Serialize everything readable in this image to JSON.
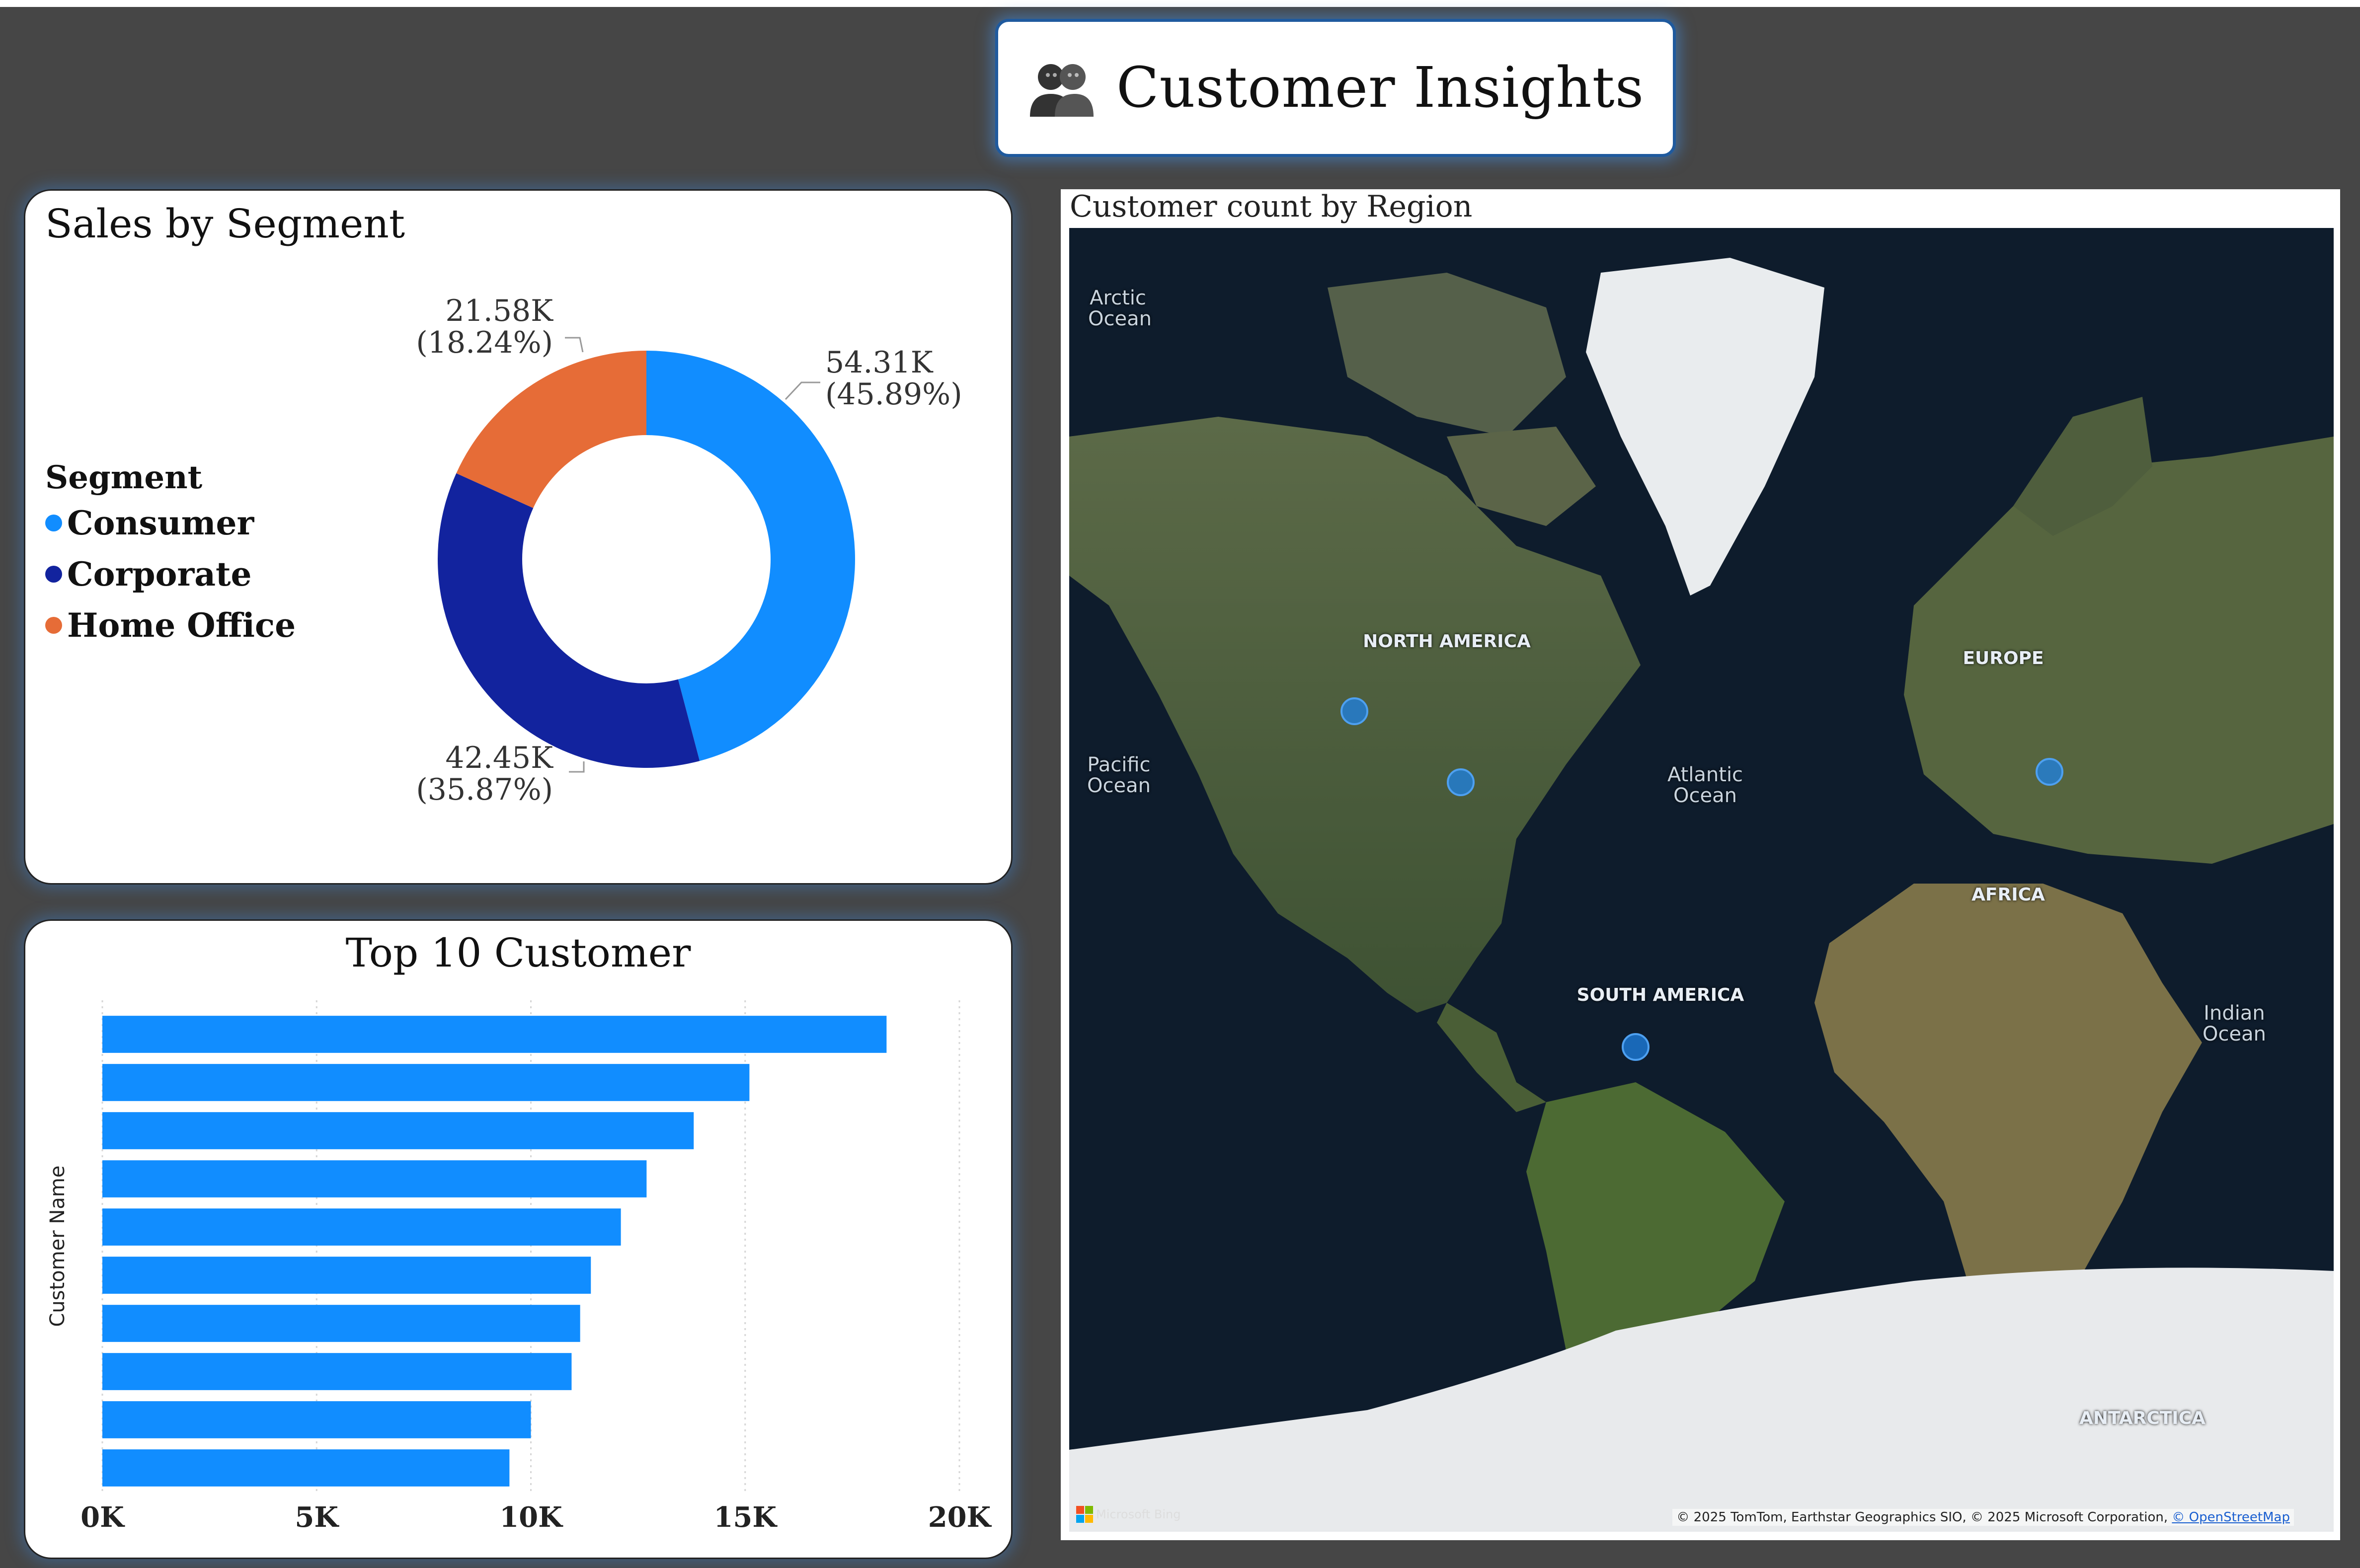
{
  "header": {
    "title": "Customer Insights",
    "icon": "people-icon"
  },
  "segment_card": {
    "title": "Sales by Segment",
    "legend_title": "Segment",
    "legend": [
      {
        "label": "Consumer",
        "color": "#118dff"
      },
      {
        "label": "Corporate",
        "color": "#12239e"
      },
      {
        "label": "Home Office",
        "color": "#e66c37"
      }
    ],
    "slice_labels": [
      {
        "value": "54.31K",
        "pct": "(45.89%)"
      },
      {
        "value": "42.45K",
        "pct": "(35.87%)"
      },
      {
        "value": "21.58K",
        "pct": "(18.24%)"
      }
    ]
  },
  "customer_card": {
    "title": "Top 10 Customer",
    "ylabel": "Customer Name",
    "x_ticks": [
      "0K",
      "5K",
      "10K",
      "15K",
      "20K"
    ]
  },
  "map_card": {
    "title": "Customer count by Region",
    "ocean_labels": [
      "Arctic Ocean",
      "Pacific Ocean",
      "Atlantic Ocean",
      "Indian Ocean"
    ],
    "continent_labels": [
      "NORTH AMERICA",
      "EUROPE",
      "AFRICA",
      "SOUTH AMERICA",
      "ANTARCTICA"
    ],
    "attribution": "© 2025 TomTom, Earthstar Geographics SIO, © 2025 Microsoft Corporation,",
    "attribution_link": "© OpenStreetMap",
    "provider": "Microsoft Bing"
  },
  "chart_data": [
    {
      "type": "pie",
      "title": "Sales by Segment",
      "categories": [
        "Consumer",
        "Corporate",
        "Home Office"
      ],
      "values": [
        54310,
        42450,
        21580
      ],
      "percentages": [
        45.89,
        35.87,
        18.24
      ],
      "colors": [
        "#118dff",
        "#12239e",
        "#e66c37"
      ],
      "donut": true,
      "legend": "left"
    },
    {
      "type": "bar",
      "orientation": "horizontal",
      "title": "Top 10 Customer",
      "ylabel": "Customer Name",
      "xlabel": "",
      "values": [
        18300,
        15100,
        13800,
        12700,
        12100,
        11400,
        11150,
        10950,
        10000,
        9500
      ],
      "xlim": [
        0,
        20000
      ],
      "x_ticks": [
        "0K",
        "5K",
        "10K",
        "15K",
        "20K"
      ],
      "color": "#118dff",
      "grid": true
    }
  ]
}
